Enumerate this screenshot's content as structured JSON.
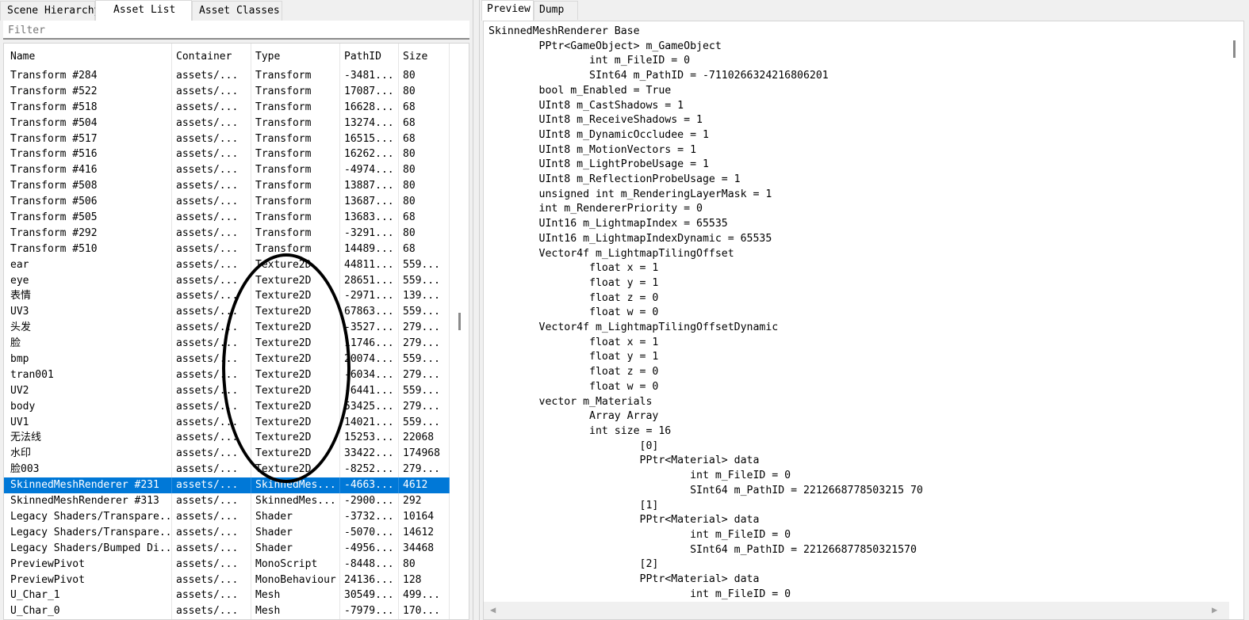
{
  "left_tabs": [
    "Scene Hierarchy",
    "Asset List",
    "Asset Classes"
  ],
  "filter_placeholder": "Filter",
  "columns": [
    "Name",
    "Container",
    "Type",
    "PathID",
    "Size"
  ],
  "rows": [
    [
      "Transform #284",
      "assets/...",
      "Transform",
      "-3481...",
      "80"
    ],
    [
      "Transform #522",
      "assets/...",
      "Transform",
      "17087...",
      "80"
    ],
    [
      "Transform #518",
      "assets/...",
      "Transform",
      "16628...",
      "68"
    ],
    [
      "Transform #504",
      "assets/...",
      "Transform",
      "13274...",
      "68"
    ],
    [
      "Transform #517",
      "assets/...",
      "Transform",
      "16515...",
      "68"
    ],
    [
      "Transform #516",
      "assets/...",
      "Transform",
      "16262...",
      "80"
    ],
    [
      "Transform #416",
      "assets/...",
      "Transform",
      "-4974...",
      "80"
    ],
    [
      "Transform #508",
      "assets/...",
      "Transform",
      "13887...",
      "80"
    ],
    [
      "Transform #506",
      "assets/...",
      "Transform",
      "13687...",
      "80"
    ],
    [
      "Transform #505",
      "assets/...",
      "Transform",
      "13683...",
      "68"
    ],
    [
      "Transform #292",
      "assets/...",
      "Transform",
      "-3291...",
      "80"
    ],
    [
      "Transform #510",
      "assets/...",
      "Transform",
      "14489...",
      "68"
    ],
    [
      "ear",
      "assets/...",
      "Texture2D",
      "44811...",
      "559..."
    ],
    [
      "eye",
      "assets/...",
      "Texture2D",
      "28651...",
      "559..."
    ],
    [
      "表情",
      "assets/...",
      "Texture2D",
      "-2971...",
      "139..."
    ],
    [
      "UV3",
      "assets/...",
      "Texture2D",
      "67863...",
      "559..."
    ],
    [
      "头发",
      "assets/...",
      "Texture2D",
      "-3527...",
      "279..."
    ],
    [
      "脸",
      "assets/...",
      "Texture2D",
      "11746...",
      "279..."
    ],
    [
      "bmp",
      "assets/...",
      "Texture2D",
      "20074...",
      "559..."
    ],
    [
      "tran001",
      "assets/...",
      "Texture2D",
      "-6034...",
      "279..."
    ],
    [
      "UV2",
      "assets/...",
      "Texture2D",
      "-6441...",
      "559..."
    ],
    [
      "body",
      "assets/...",
      "Texture2D",
      "53425...",
      "279..."
    ],
    [
      "UV1",
      "assets/...",
      "Texture2D",
      "14021...",
      "559..."
    ],
    [
      "无法线",
      "assets/...",
      "Texture2D",
      "15253...",
      "22068"
    ],
    [
      "水印",
      "assets/...",
      "Texture2D",
      "33422...",
      "174968"
    ],
    [
      "脸003",
      "assets/...",
      "Texture2D",
      "-8252...",
      "279..."
    ],
    [
      "SkinnedMeshRenderer #231",
      "assets/...",
      "SkinnedMes...",
      "-4663...",
      "4612"
    ],
    [
      "SkinnedMeshRenderer #313",
      "assets/...",
      "SkinnedMes...",
      "-2900...",
      "292"
    ],
    [
      "Legacy Shaders/Transpare...",
      "assets/...",
      "Shader",
      "-3732...",
      "10164"
    ],
    [
      "Legacy Shaders/Transpare...",
      "assets/...",
      "Shader",
      "-5070...",
      "14612"
    ],
    [
      "Legacy Shaders/Bumped Di...",
      "assets/...",
      "Shader",
      "-4956...",
      "34468"
    ],
    [
      "PreviewPivot",
      "assets/...",
      "MonoScript",
      "-8448...",
      "80"
    ],
    [
      "PreviewPivot",
      "assets/...",
      "MonoBehaviour",
      "24136...",
      "128"
    ],
    [
      "U_Char_1",
      "assets/...",
      "Mesh",
      "30549...",
      "499..."
    ],
    [
      "U_Char_0",
      "assets/...",
      "Mesh",
      "-7979...",
      "170..."
    ]
  ],
  "selected_row": 26,
  "right_tabs": [
    "Preview",
    "Dump"
  ],
  "dump_lines": [
    "SkinnedMeshRenderer Base",
    "        PPtr<GameObject> m_GameObject",
    "                int m_FileID = 0",
    "                SInt64 m_PathID = -7110266324216806201",
    "        bool m_Enabled = True",
    "        UInt8 m_CastShadows = 1",
    "        UInt8 m_ReceiveShadows = 1",
    "        UInt8 m_DynamicOccludee = 1",
    "        UInt8 m_MotionVectors = 1",
    "        UInt8 m_LightProbeUsage = 1",
    "        UInt8 m_ReflectionProbeUsage = 1",
    "        unsigned int m_RenderingLayerMask = 1",
    "        int m_RendererPriority = 0",
    "        UInt16 m_LightmapIndex = 65535",
    "        UInt16 m_LightmapIndexDynamic = 65535",
    "        Vector4f m_LightmapTilingOffset",
    "                float x = 1",
    "                float y = 1",
    "                float z = 0",
    "                float w = 0",
    "        Vector4f m_LightmapTilingOffsetDynamic",
    "                float x = 1",
    "                float y = 1",
    "                float z = 0",
    "                float w = 0",
    "        vector m_Materials",
    "                Array Array",
    "                int size = 16",
    "                        [0]",
    "                        PPtr<Material> data",
    "                                int m_FileID = 0",
    "                                SInt64 m_PathID = 2212668778503215 70",
    "                        [1]",
    "                        PPtr<Material> data",
    "                                int m_FileID = 0",
    "                                SInt64 m_PathID = 221266877850321570",
    "                        [2]",
    "                        PPtr<Material> data",
    "                                int m_FileID = 0"
  ],
  "icons": {
    "scroll_left": "◀",
    "scroll_right": "▶"
  }
}
